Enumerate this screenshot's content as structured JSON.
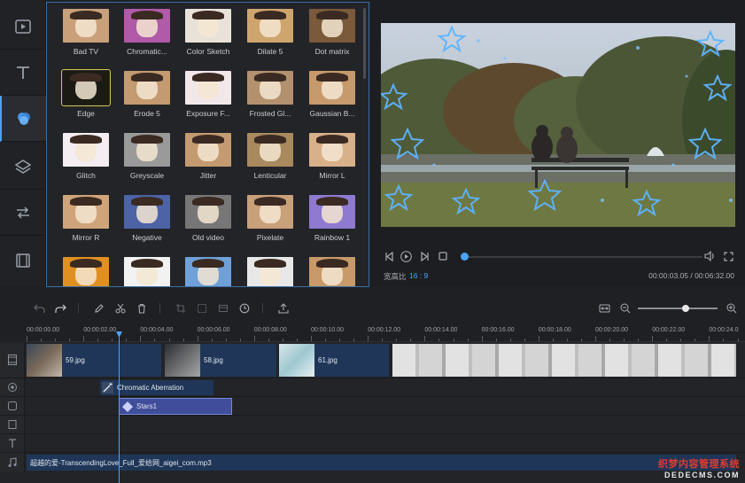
{
  "sidebar": {
    "items": [
      {
        "icon": "media-icon"
      },
      {
        "icon": "text-icon"
      },
      {
        "icon": "filters-icon",
        "active": true
      },
      {
        "icon": "overlays-icon"
      },
      {
        "icon": "transitions-icon"
      },
      {
        "icon": "elements-icon"
      }
    ]
  },
  "effects": [
    {
      "label": "Bad TV",
      "tint": "#c9a07a"
    },
    {
      "label": "Chromatic...",
      "tint": "#b05aa8"
    },
    {
      "label": "Color Sketch",
      "tint": "#e8e2d8"
    },
    {
      "label": "Dilate 5",
      "tint": "#cfa56e"
    },
    {
      "label": "Dot matrix",
      "tint": "#7a5a3a"
    },
    {
      "label": "Edge",
      "tint": "#1b1b14",
      "selected": true
    },
    {
      "label": "Erode 5",
      "tint": "#c49a70"
    },
    {
      "label": "Exposure F...",
      "tint": "#f2e8ea"
    },
    {
      "label": "Frosted Gl...",
      "tint": "#b3916e"
    },
    {
      "label": "Gaussian B...",
      "tint": "#c69a6c"
    },
    {
      "label": "Glitch",
      "tint": "#f4eef2"
    },
    {
      "label": "Greyscale",
      "tint": "#9a9a9a"
    },
    {
      "label": "Jitter",
      "tint": "#c49a70"
    },
    {
      "label": "Lenticular",
      "tint": "#a88a5e"
    },
    {
      "label": "Mirror L",
      "tint": "#d8b08a"
    },
    {
      "label": "Mirror R",
      "tint": "#d0a47a"
    },
    {
      "label": "Negative",
      "tint": "#4d63a6"
    },
    {
      "label": "Old video",
      "tint": "#777777"
    },
    {
      "label": "Pixelate",
      "tint": "#c8a07a"
    },
    {
      "label": "Rainbow 1",
      "tint": "#8e7ad0"
    },
    {
      "label": "",
      "tint": "#e09020"
    },
    {
      "label": "",
      "tint": "#f2f2f2"
    },
    {
      "label": "",
      "tint": "#6fa0d8"
    },
    {
      "label": "",
      "tint": "#e8e8e8"
    },
    {
      "label": "",
      "tint": "#c89a6a"
    }
  ],
  "preview": {
    "ratio_label": "宽高比",
    "ratio_value": "16 : 9",
    "timecode": "00:00:03.05 / 00:06:32.00",
    "progress": 0.01
  },
  "ruler": {
    "ticks": [
      "00:00:00.00",
      "00:00:02.00",
      "00:00:04.00",
      "00:00:06.00",
      "00:00:08.00",
      "00:00:10.00",
      "00:00:12.00",
      "00:00:14.00",
      "00:00:16.00",
      "00:00:18.00",
      "00:00:20.00",
      "00:00:22.00",
      "00:00:24.0"
    ]
  },
  "timeline": {
    "video_clips": [
      "59.jpg",
      "58.jpg",
      "61.jpg"
    ],
    "filter_clip": "Chromatic Aberration",
    "overlay_clip": "Stars1",
    "music_clip": "超越的爱-TranscendingLove_Full_爱给网_aigei_com.mp3"
  },
  "watermark": {
    "line1": "织梦内容管理系统",
    "line2": "DEDECMS.COM"
  },
  "colors": {
    "accent": "#4aa3ff",
    "selected_effect_border": "#d4c24a",
    "clip_blue": "#1f3658"
  }
}
